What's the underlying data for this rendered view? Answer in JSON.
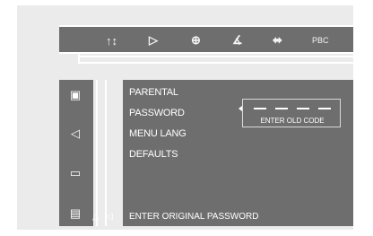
{
  "topbar": {
    "icons": [
      {
        "name": "settings-icon",
        "glyph": "↑↕"
      },
      {
        "name": "play-icon",
        "glyph": "▷"
      },
      {
        "name": "zoom-icon",
        "glyph": "⊕"
      },
      {
        "name": "angle-icon",
        "glyph": "∡"
      },
      {
        "name": "audio-channel-icon",
        "glyph": "⬌"
      }
    ],
    "pbc_label": "PBC"
  },
  "sidebar": {
    "icons": [
      {
        "name": "person-icon",
        "glyph": "▣"
      },
      {
        "name": "speaker-icon",
        "glyph": "◁"
      },
      {
        "name": "subtitle-icon",
        "glyph": "▭"
      },
      {
        "name": "lock-icon",
        "glyph": "▤"
      }
    ]
  },
  "menu": {
    "items": [
      {
        "label": "PARENTAL"
      },
      {
        "label": "PASSWORD"
      },
      {
        "label": "MENU LANG"
      },
      {
        "label": "DEFAULTS"
      }
    ]
  },
  "code_entry": {
    "label": "ENTER OLD CODE"
  },
  "status": {
    "message": "ENTER ORIGINAL PASSWORD"
  },
  "nav": {
    "up": "△",
    "left": "◁"
  },
  "colors": {
    "panel": "#6e6e6e",
    "frame": "#ebebeb",
    "text": "#ffffff"
  }
}
